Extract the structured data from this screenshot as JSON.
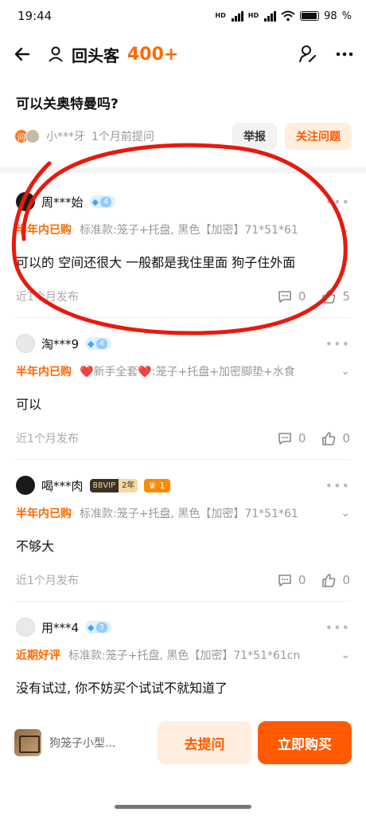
{
  "status": {
    "time": "19:44",
    "sim1": "HD",
    "sim2": "HD",
    "battery": "98"
  },
  "header": {
    "title": "回头客",
    "count": "400+"
  },
  "question": {
    "text": "可以关奥特曼吗?",
    "ask_badge": "问",
    "asker": "小***牙",
    "time": "1个月前提问",
    "report_label": "举报",
    "follow_label": "关注问题"
  },
  "answers": [
    {
      "user": "周***始",
      "level": "4",
      "tag": "半年内已购",
      "spec": "标准款:笼子+托盘, 黑色【加密】71*51*61",
      "text": "可以的 空间还很大 一般都是我住里面 狗子住外面",
      "time": "近1个月发布",
      "comments": "0",
      "likes": "5"
    },
    {
      "user": "淘***9",
      "level": "4",
      "tag": "半年内已购",
      "spec": "❤️新手全套❤️:笼子+托盘+加密脚垫+水食",
      "text": "可以",
      "time": "近1个月发布",
      "comments": "0",
      "likes": "0"
    },
    {
      "user": "喝***肉",
      "vip_a": "88VIP",
      "vip_b": "2年",
      "crown_level": "1",
      "tag": "半年内已购",
      "spec": "标准款:笼子+托盘, 黑色【加密】71*51*61",
      "text": "不够大",
      "time": "近1个月发布",
      "comments": "0",
      "likes": "0"
    },
    {
      "user": "用***4",
      "level": "3",
      "tag": "近期好评",
      "spec": "标准款:笼子+托盘, 黑色【加密】71*51*61cn",
      "text": "没有试过, 你不妨买个试试不就知道了"
    }
  ],
  "bottom": {
    "product_name": "狗笼子小型...",
    "ask_label": "去提问",
    "buy_label": "立即购买"
  },
  "colors": {
    "accent": "#ff5a00",
    "annotation": "#e8190f"
  }
}
